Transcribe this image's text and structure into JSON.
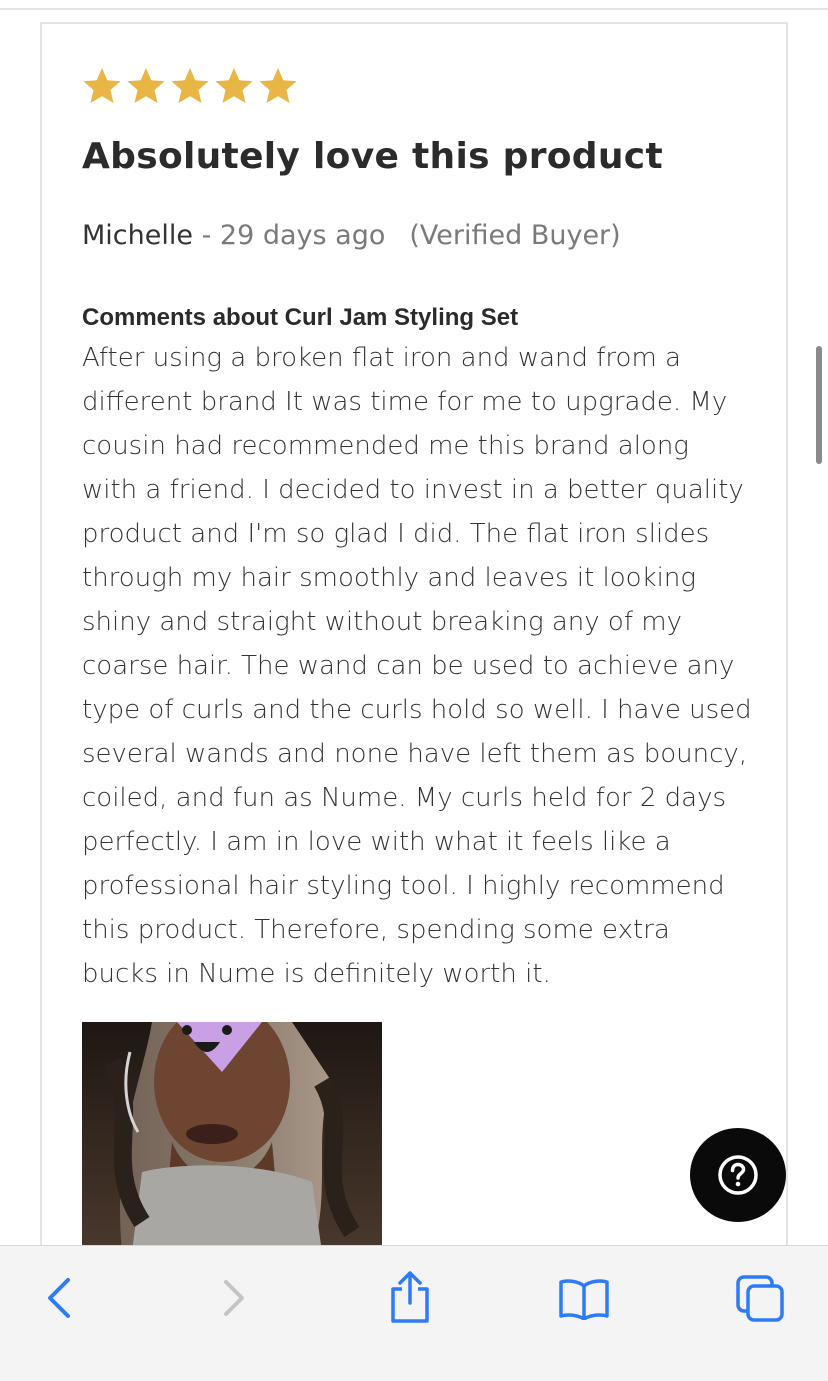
{
  "review": {
    "rating": 5,
    "rating_max": 5,
    "star_color": "#e9b545",
    "title": "Absolutely love this product",
    "author": "Michelle",
    "separator": " - ",
    "date": "29 days ago",
    "verified": "(Verified Buyer)",
    "comments_heading": "Comments about Curl Jam Styling Set",
    "body_lines": [
      "After using a broken flat iron and wand from a",
      "different brand It was time for me to upgrade. My",
      "cousin had recommended me this brand along",
      "with a friend. I decided to invest in a better quality",
      "product and I'm so glad I did. The flat iron slides",
      "through my hair smoothly and leaves it looking",
      "shiny and straight without breaking any of my",
      "coarse hair. The wand can be used to achieve any",
      "type of curls and the curls hold so well. I have used",
      "several wands and none have left them as bouncy,",
      "coiled, and fun as Nume. My curls held for 2 days",
      "perfectly. I am in love with what it feels like a",
      "professional hair styling tool. I highly recommend",
      "this product. Therefore, spending some extra",
      "bucks in Nume is definitely worth it."
    ]
  },
  "help_button": {
    "icon": "question-mark-icon",
    "color": "#0a0a0a"
  },
  "toolbar": {
    "accent": "#2f7bf5",
    "disabled": "#c4c4c4",
    "items": [
      {
        "name": "back",
        "icon": "chevron-left-icon",
        "enabled": true
      },
      {
        "name": "forward",
        "icon": "chevron-right-icon",
        "enabled": false
      },
      {
        "name": "share",
        "icon": "share-icon",
        "enabled": true
      },
      {
        "name": "bookmarks",
        "icon": "book-icon",
        "enabled": true
      },
      {
        "name": "tabs",
        "icon": "tabs-icon",
        "enabled": true
      }
    ]
  }
}
